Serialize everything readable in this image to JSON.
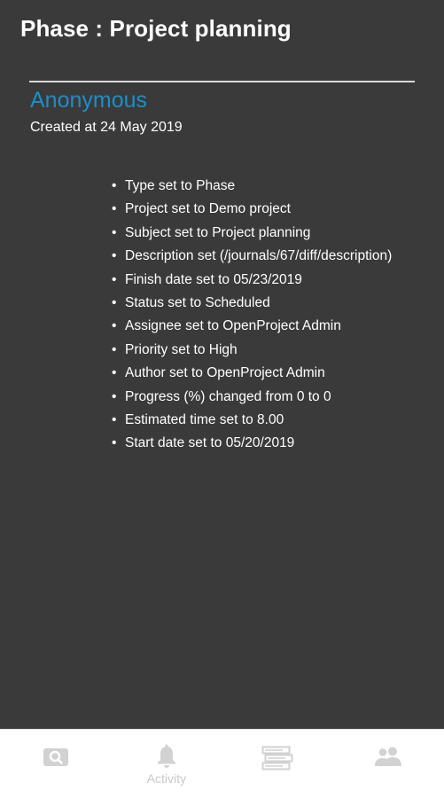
{
  "header": {
    "title": "Phase : Project planning"
  },
  "journal": {
    "author": "Anonymous",
    "created": "Created at 24 May 2019",
    "changes": [
      "Type set to Phase",
      "Project set to Demo project",
      "Subject set to Project planning",
      "Description set (/journals/67/diff/description)",
      "Finish date set to 05/23/2019",
      "Status set to Scheduled",
      "Assignee set to OpenProject Admin",
      "Priority set to High",
      "Author set to OpenProject Admin",
      "Progress (%) changed from 0 to 0",
      "Estimated time set to 8.00",
      "Start date set to 05/20/2019"
    ]
  },
  "bottom_nav": {
    "tabs": [
      {
        "label": "",
        "icon": "search-icon"
      },
      {
        "label": "Activity",
        "icon": "bell-icon"
      },
      {
        "label": "",
        "icon": "list-icon"
      },
      {
        "label": "",
        "icon": "people-icon"
      }
    ]
  },
  "colors": {
    "background": "#3a3a3a",
    "author": "#1a8fc9",
    "nav_icon": "#d0d0d0"
  }
}
